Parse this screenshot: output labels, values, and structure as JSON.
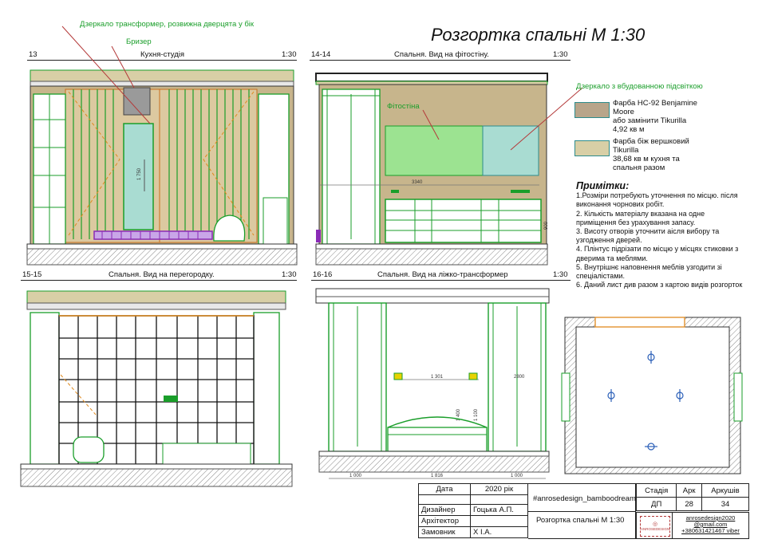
{
  "sheet_title": "Розгортка спальні М 1:30",
  "views": [
    {
      "num": "13",
      "name": "Кухня-студія",
      "scale": "1:30"
    },
    {
      "num": "14-14",
      "name": "Спальня. Вид на фітостіну.",
      "scale": "1:30"
    },
    {
      "num": "15-15",
      "name": "Спальня. Вид на перегородку.",
      "scale": "1:30"
    },
    {
      "num": "16-16",
      "name": "Спальня. Вид на ліжко-трансформер",
      "scale": "1:30"
    }
  ],
  "annotations": {
    "mirror_transformer": "Дзеркало трансформер, розвижна дверцята у бік",
    "breather": "Бризер",
    "phytowall": "Фітостіна",
    "mirror_backlit": "Дзеркало з вбудованною підсвіткою"
  },
  "legend": [
    {
      "color": "#b8a58a",
      "lines": [
        "Фарба HC-92 Benjamine",
        "Moore",
        "або замінити Tikurilla",
        "4,92 кв м"
      ]
    },
    {
      "color": "#d8cfa6",
      "lines": [
        "Фарба біж вершковий",
        "Tikurilla",
        "38,68 кв м кухня та",
        "спальня разом"
      ]
    }
  ],
  "notes": {
    "heading": "Примітки:",
    "items": [
      "1.Розміри потребують уточнення по місцю. після виконання чорнових робіт.",
      "2. Кількість матеріалу вказана на одне приміщення без урахування запасу.",
      "3. Висоту отворів уточнити аісля вибору та узгодження дверей.",
      "4. Плінтус підрізати по місцю у місцях стиковки з дверима та меблями.",
      "5. Внутрішнє наповнення меблів узгодити зі спеціалістами.",
      "6. Даний лист див разом з картою видів розгорток"
    ]
  },
  "dimensions": {
    "v13_height": "1 750",
    "v14_width": "3340",
    "v14_height": "900",
    "v16_span": "1 301",
    "v16_right": "2800",
    "v16_h1": "1 400",
    "v16_h2": "1 100",
    "v16_bottom": [
      "1 000",
      "1 816",
      "1 000"
    ]
  },
  "title_block": {
    "date_label": "Дата",
    "date_value": "2020 рік",
    "designer_label": "Дизайнер",
    "designer_value": "Гоцька А.П.",
    "architect_label": "Архітектор",
    "client_label": "Замовник",
    "client_value": "Х          І.А.",
    "project": "#anrosedesign_bamboodream",
    "sheet_name": "Розгортка спальні М 1:30",
    "stage_label": "Стадія",
    "stage_value": "ДП",
    "sheet_label": "Арк",
    "sheet_value": "28",
    "sheets_label": "Аркушів",
    "sheets_value": "34",
    "logo_text": "ANROSEDESIGN",
    "contact_email_1": "anrosedesign2020",
    "contact_email_2": "@gmail.com",
    "contact_phone": "+380631421467 viber"
  }
}
